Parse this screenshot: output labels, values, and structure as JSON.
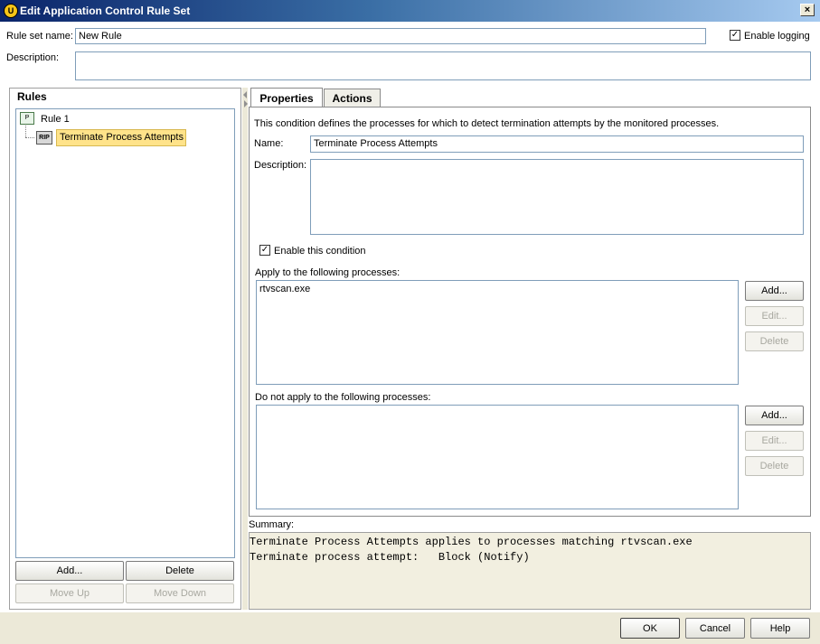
{
  "window": {
    "title": "Edit Application Control Rule Set",
    "close_label": "×",
    "app_icon_glyph": "U"
  },
  "header": {
    "rule_set_name_label": "Rule set name:",
    "rule_set_name_value": "New Rule",
    "enable_logging_label": "Enable logging",
    "enable_logging_checked": true,
    "description_label": "Description:",
    "description_value": ""
  },
  "rules_panel": {
    "title": "Rules",
    "tree": [
      {
        "label": "Rule 1",
        "icon": "rule-icon"
      },
      {
        "label": "Terminate Process Attempts",
        "icon": "rip-condition-icon",
        "icon_text": "RIP",
        "selected": true
      }
    ],
    "buttons": {
      "add": "Add...",
      "delete": "Delete",
      "move_up": "Move Up",
      "move_down": "Move Down"
    }
  },
  "tabs": [
    {
      "label": "Properties",
      "active": true
    },
    {
      "label": "Actions",
      "active": false
    }
  ],
  "properties": {
    "intro": "This condition defines the processes for which to detect termination attempts by the monitored processes.",
    "name_label": "Name:",
    "name_value": "Terminate Process Attempts",
    "description_label": "Description:",
    "description_value": "",
    "enable_condition_label": "Enable this condition",
    "enable_condition_checked": true,
    "apply_label": "Apply to the following processes:",
    "apply_items": [
      "rtvscan.exe"
    ],
    "not_apply_label": "Do not apply to the following processes:",
    "not_apply_items": [],
    "add_label": "Add...",
    "edit_label": "Edit...",
    "delete_label": "Delete"
  },
  "summary": {
    "label": "Summary:",
    "line1": "Terminate Process Attempts applies to processes matching rtvscan.exe",
    "line2": "Terminate process attempt:   Block (Notify)"
  },
  "footer": {
    "ok": "OK",
    "cancel": "Cancel",
    "help": "Help"
  },
  "colors": {
    "titlebar_start": "#0a246a",
    "selection_bg": "#ffe38a",
    "summary_bg": "#f2efe0"
  }
}
